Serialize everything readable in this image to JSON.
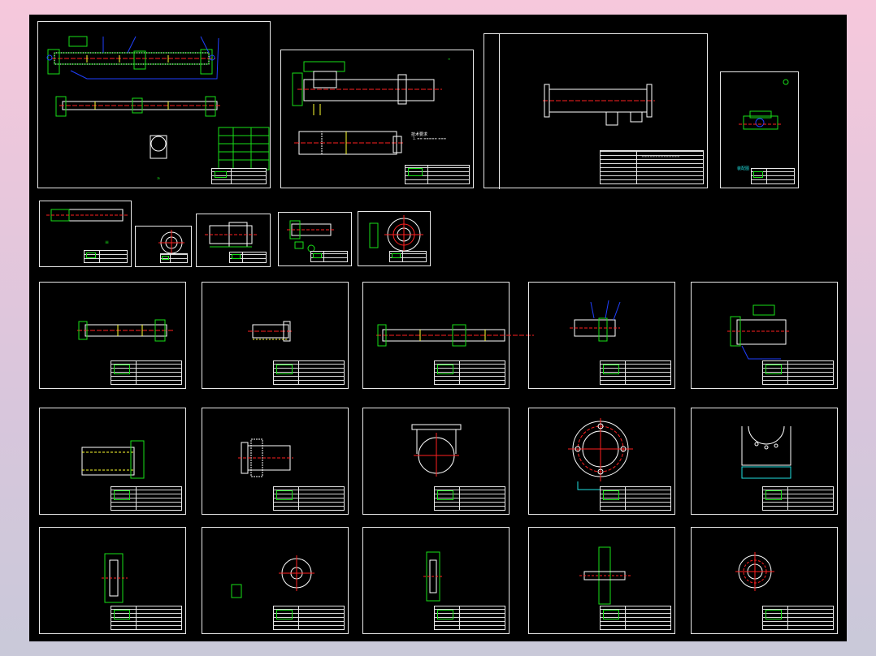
{
  "viewer": {
    "background_color": "#000000",
    "line_colors": {
      "outline": "#ffffff",
      "green": "#18e018",
      "red_centerline": "#ff2020",
      "yellow": "#ffff30",
      "blue_leader": "#2040ff",
      "cyan": "#20e0e0",
      "magenta": "#ff40ff"
    }
  },
  "sheets": {
    "s4_caption": "装配图",
    "s2_note": "技术要求"
  }
}
